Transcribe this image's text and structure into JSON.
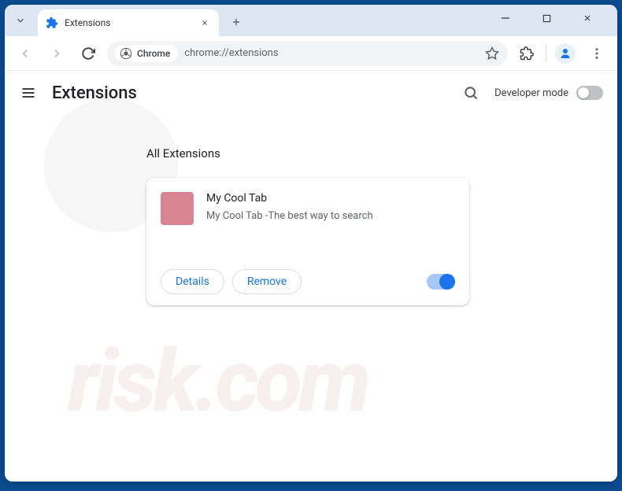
{
  "tab": {
    "title": "Extensions"
  },
  "omnibox": {
    "chip_label": "Chrome",
    "url": "chrome://extensions"
  },
  "header": {
    "title": "Extensions",
    "dev_mode_label": "Developer mode",
    "dev_mode_on": false
  },
  "section": {
    "title": "All Extensions"
  },
  "extension": {
    "name": "My Cool Tab",
    "description": "My Cool Tab -The best way to search",
    "details_label": "Details",
    "remove_label": "Remove",
    "enabled": true,
    "icon_color": "#d68591"
  }
}
